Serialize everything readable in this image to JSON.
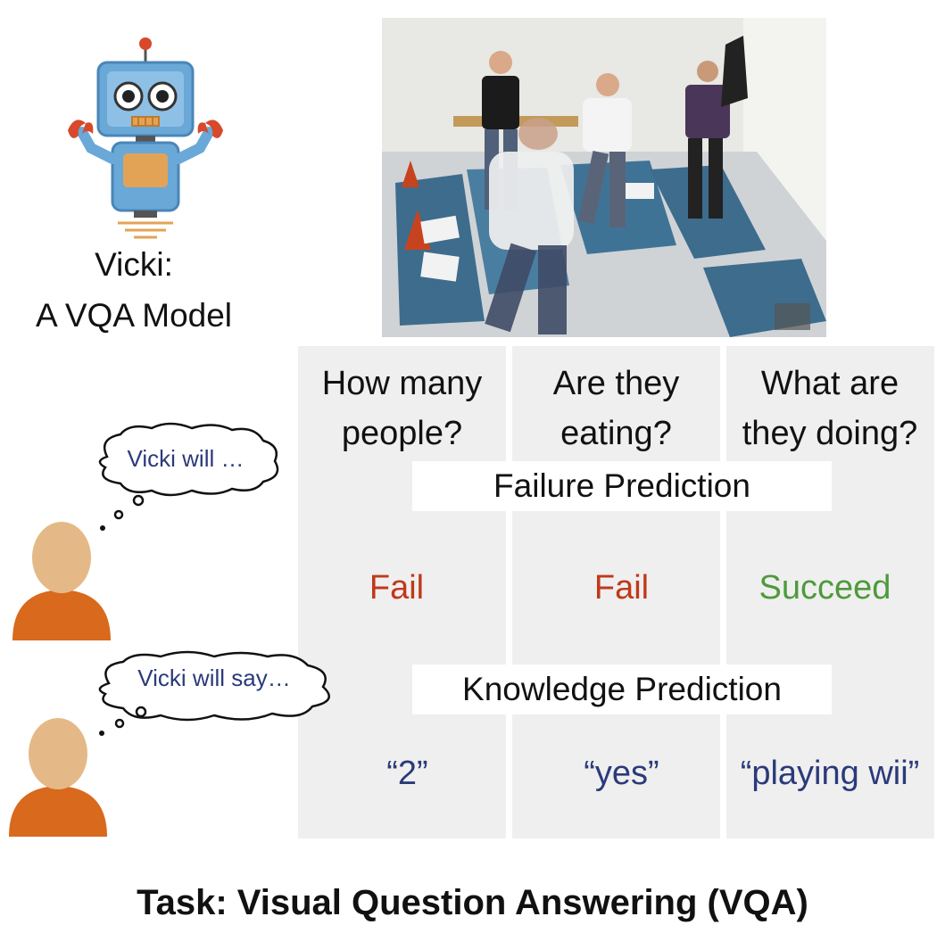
{
  "model": {
    "name": "Vicki:",
    "description": "A VQA Model"
  },
  "questions": [
    "How many people?",
    "Are they eating?",
    "What are they doing?"
  ],
  "question_lines": [
    [
      "How many",
      "people?"
    ],
    [
      "Are they",
      "eating?"
    ],
    [
      "What are",
      "they doing?"
    ]
  ],
  "failure_prediction": {
    "title": "Failure Prediction",
    "bubble": "Vicki will …",
    "results": [
      "Fail",
      "Fail",
      "Succeed"
    ]
  },
  "knowledge_prediction": {
    "title": "Knowledge Prediction",
    "bubble": "Vicki will say…",
    "answers": [
      "“2”",
      "“yes”",
      "“playing wii”"
    ]
  },
  "caption": "Task: Visual Question Answering (VQA)",
  "colors": {
    "fail": "#c0391b",
    "succeed": "#4e9a3c",
    "answer": "#2b3a7a",
    "human_head": "#e4b987",
    "human_body": "#d9691c",
    "column_bg": "#efefef",
    "robot_blue": "#6aa8d8",
    "robot_orange": "#e2a356"
  }
}
